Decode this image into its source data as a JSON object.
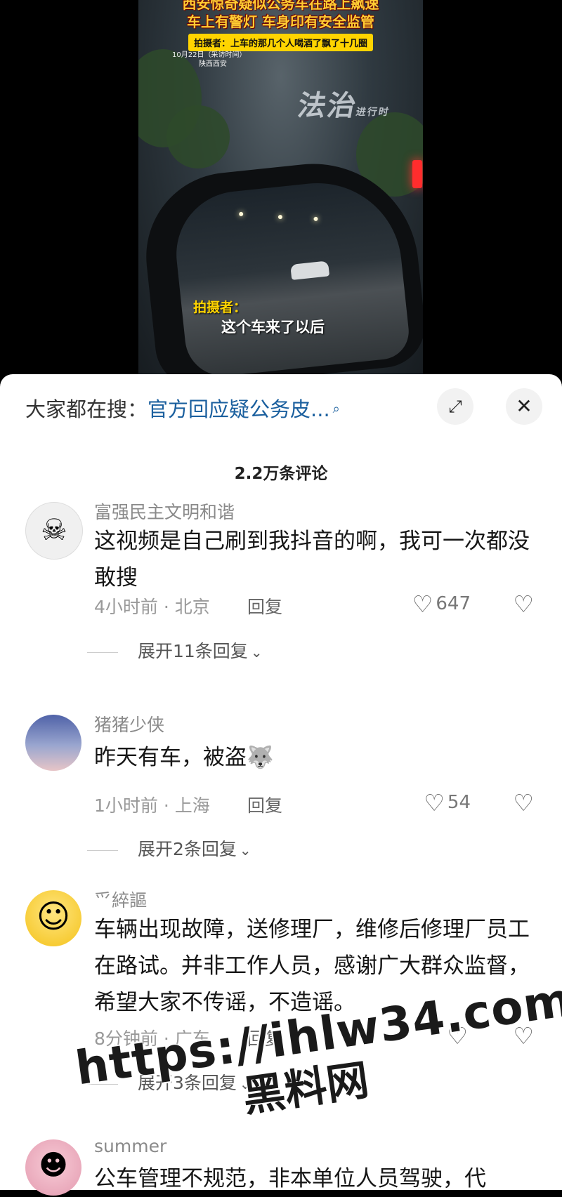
{
  "video": {
    "headline": "西安惊奇疑似公务车在路上飙速",
    "headline2": "车上有警灯 车身印有安全监管",
    "subline": "拍摄者：上车的那几个人喝酒了飘了十几圈",
    "date_line1": "10月22日（采访时间）",
    "date_line2": "陕西西安",
    "brand": "法治",
    "brand_sub": "进行时",
    "subtitle_name": "拍摄者：",
    "subtitle_text": "这个车来了以后"
  },
  "sheet": {
    "search_prefix": "大家都在搜：",
    "search_link": "官方回应疑公务皮...",
    "comment_count": "2.2万条评论"
  },
  "comments": [
    {
      "user": "富强民主文明和谐",
      "avatar_icon": "skeleton-avatar",
      "text": "这视频是自己刷到我抖音的啊，我可一次都没敢搜",
      "time_loc": "4小时前 · 北京",
      "reply": "回复",
      "likes": "647",
      "expand": "展开11条回复"
    },
    {
      "user": "猪猪少侠",
      "avatar_icon": "sky-avatar",
      "text": "昨天有车，被盗🐺",
      "time_loc": "1小时前 · 上海",
      "reply": "回复",
      "likes": "54",
      "expand": "展开2条回复"
    },
    {
      "user": "爫綷謳",
      "avatar_icon": "blushing-emoji-avatar",
      "text": "车辆出现故障，送修理厂，维修后修理厂员工在路试。并非工作人员，感谢广大群众监督，希望大家不传谣，不造谣。",
      "time_loc": "8分钟前 · 广东",
      "reply": "回复",
      "likes": "",
      "expand": "展开3条回复"
    },
    {
      "user": "summer",
      "avatar_icon": "child-photo-avatar",
      "text": "公车管理不规范，非本单位人员驾驶，代"
    }
  ],
  "watermark": {
    "url": "https://ihlw34.com",
    "name": "黑料网"
  }
}
